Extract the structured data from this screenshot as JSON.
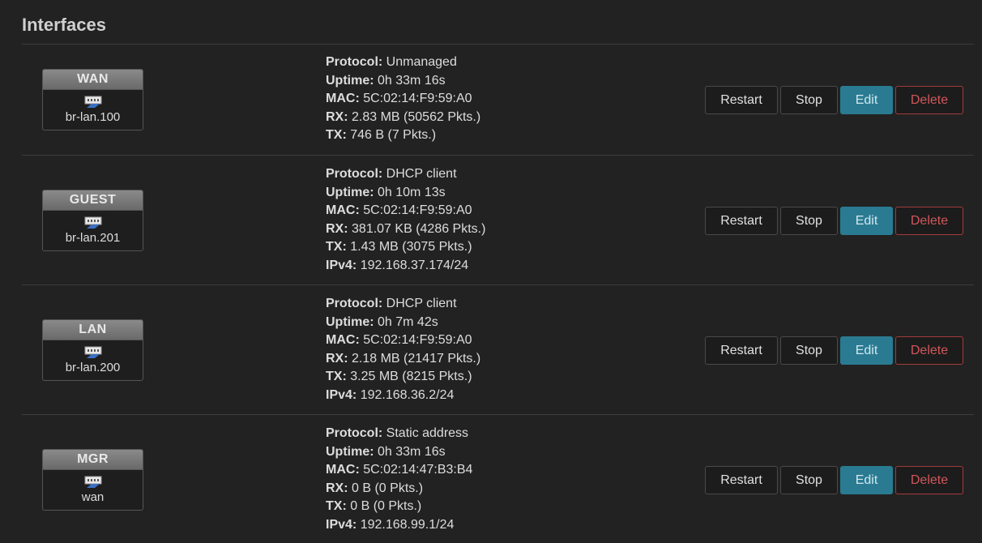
{
  "page": {
    "title": "Interfaces"
  },
  "labels": {
    "protocol": "Protocol:",
    "uptime": "Uptime:",
    "mac": "MAC:",
    "rx": "RX:",
    "tx": "TX:",
    "ipv4": "IPv4:"
  },
  "buttons": {
    "restart": "Restart",
    "stop": "Stop",
    "edit": "Edit",
    "delete": "Delete"
  },
  "icons": {
    "interface": "ethernet-port-icon"
  },
  "colors": {
    "edit_button": "#2a7b92",
    "delete_button": "#d0575b",
    "background": "#222222"
  },
  "interfaces": [
    {
      "name": "WAN",
      "device": "br-lan.100",
      "protocol": "Unmanaged",
      "uptime": "0h 33m 16s",
      "mac": "5C:02:14:F9:59:A0",
      "rx": "2.83 MB (50562 Pkts.)",
      "tx": "746 B (7 Pkts.)"
    },
    {
      "name": "GUEST",
      "device": "br-lan.201",
      "protocol": "DHCP client",
      "uptime": "0h 10m 13s",
      "mac": "5C:02:14:F9:59:A0",
      "rx": "381.07 KB (4286 Pkts.)",
      "tx": "1.43 MB (3075 Pkts.)",
      "ipv4": "192.168.37.174/24"
    },
    {
      "name": "LAN",
      "device": "br-lan.200",
      "protocol": "DHCP client",
      "uptime": "0h 7m 42s",
      "mac": "5C:02:14:F9:59:A0",
      "rx": "2.18 MB (21417 Pkts.)",
      "tx": "3.25 MB (8215 Pkts.)",
      "ipv4": "192.168.36.2/24"
    },
    {
      "name": "MGR",
      "device": "wan",
      "protocol": "Static address",
      "uptime": "0h 33m 16s",
      "mac": "5C:02:14:47:B3:B4",
      "rx": "0 B (0 Pkts.)",
      "tx": "0 B (0 Pkts.)",
      "ipv4": "192.168.99.1/24"
    }
  ]
}
